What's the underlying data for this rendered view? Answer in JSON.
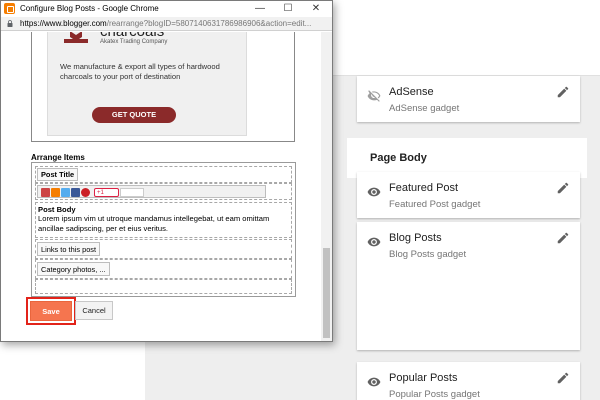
{
  "window": {
    "title": "Configure Blog Posts - Google Chrome",
    "url_host": "https://www.blogger.com",
    "url_rest": "/rearrange?blogID=5807140631786986906&action=edit...",
    "min_glyph": "—",
    "max_glyph": "☐",
    "close_glyph": "✕"
  },
  "ad": {
    "headline": "charcoals",
    "company": "Akatex Trading Company",
    "description": "We manufacture & export all types of hardwood charcoals to your port of destination",
    "cta": "GET QUOTE"
  },
  "arrange": {
    "label": "Arrange Items",
    "post_title": "Post Title",
    "plus_one": "+1",
    "post_body_title": "Post Body",
    "post_body_text": "Lorem ipsum vim ut utroque mandamus intellegebat, ut eam omittam ancillae sadipscing, per et eius veritus.",
    "links": "Links to this post",
    "category": "Category photos, ..."
  },
  "buttons": {
    "save": "Save",
    "cancel": "Cancel"
  },
  "layout_page": {
    "section_title": "Page Body",
    "gadgets": [
      {
        "title": "AdSense",
        "subtitle": "AdSense gadget",
        "icon": "eye-off-icon"
      },
      {
        "title": "Featured Post",
        "subtitle": "Featured Post gadget",
        "icon": "eye-icon"
      },
      {
        "title": "Blog Posts",
        "subtitle": "Blog Posts gadget",
        "icon": "eye-icon"
      },
      {
        "title": "Popular Posts",
        "subtitle": "Popular Posts gadget",
        "icon": "eye-icon"
      }
    ]
  },
  "colors": {
    "save_button": "#f5754f",
    "highlight": "#e2231a",
    "cta": "#8b2a2a",
    "blogger_orange": "#f57d00"
  }
}
